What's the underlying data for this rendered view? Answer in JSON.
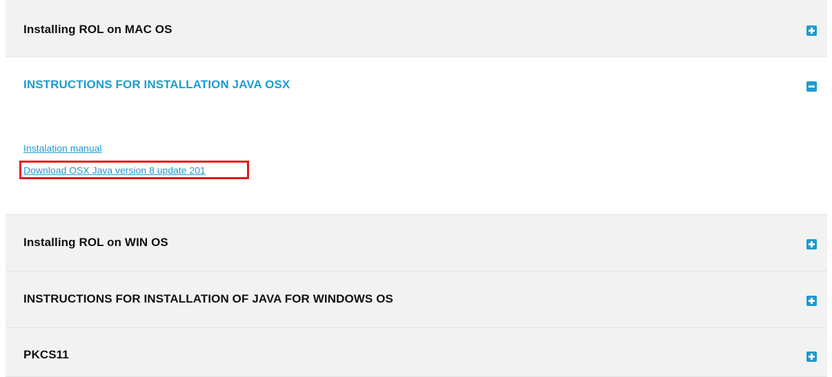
{
  "accordion": {
    "sections": [
      {
        "title": "Installing ROL on MAC OS",
        "state": "collapsed"
      },
      {
        "title": "INSTRUCTIONS FOR INSTALLATION JAVA OSX",
        "state": "expanded"
      },
      {
        "title": "Installing ROL on WIN OS",
        "state": "collapsed"
      },
      {
        "title": "INSTRUCTIONS FOR INSTALLATION OF JAVA FOR WINDOWS OS",
        "state": "collapsed"
      },
      {
        "title": "PKCS11",
        "state": "collapsed"
      }
    ],
    "expanded_links": [
      {
        "label": "Instalation manual"
      },
      {
        "label": "Download OSX Java version 8 update 201",
        "highlighted": true
      }
    ]
  },
  "colors": {
    "accent": "#1e9bcf",
    "highlight": "#e5141c",
    "header_bg": "#f2f2f2"
  },
  "icons": {
    "expand": "plus-square-icon",
    "collapse": "minus-square-icon"
  }
}
